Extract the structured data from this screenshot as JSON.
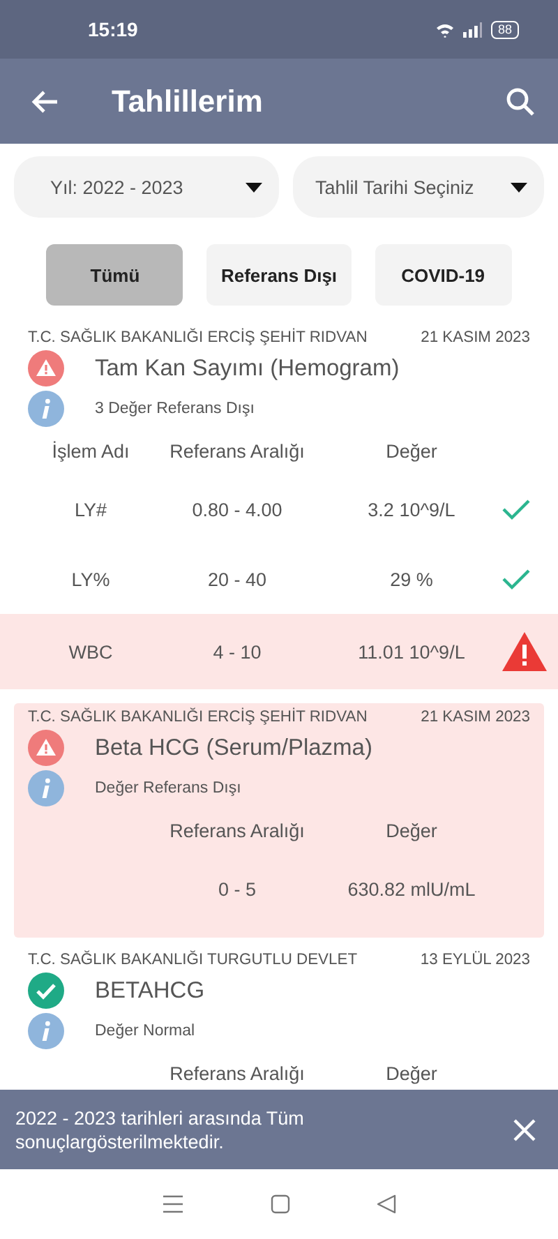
{
  "status_bar": {
    "time": "15:19",
    "battery": "88"
  },
  "app_bar": {
    "title": "Tahlillerim"
  },
  "filters": [
    {
      "value": "Yıl: 2022 - 2023"
    },
    {
      "value": "Tahlil Tarihi Seçiniz"
    }
  ],
  "tabs": [
    {
      "label": "Tümü",
      "selected": true
    },
    {
      "label": "Referans Dışı",
      "selected": false
    },
    {
      "label": "COVID-19",
      "selected": false
    }
  ],
  "results": [
    {
      "hospital": "T.C. SAĞLIK BAKANLIĞI ERCİŞ ŞEHİT RIDVAN",
      "date": "21 KASIM 2023",
      "kind": "alert",
      "highlighted": false,
      "title": "Tam Kan Sayımı (Hemogram)",
      "note": "3 Değer Referans Dışı",
      "columns": [
        {
          "kind": "name",
          "label": "İşlem Adı"
        },
        {
          "kind": "range",
          "label": "Referans Aralığı"
        },
        {
          "kind": "value",
          "label": "Değer"
        }
      ],
      "rows": [
        {
          "name": "LY#",
          "range": "0.80 - 4.00",
          "value": "3.2 10^9/L",
          "kind": "normal"
        },
        {
          "name": "LY%",
          "range": "20 - 40",
          "value": "29 %",
          "kind": "normal"
        },
        {
          "name": "WBC",
          "range": "4 - 10",
          "value": "11.01 10^9/L",
          "kind": "high"
        }
      ]
    },
    {
      "hospital": "T.C. SAĞLIK BAKANLIĞI ERCİŞ ŞEHİT RIDVAN",
      "date": "21 KASIM 2023",
      "kind": "alert",
      "highlighted": true,
      "title": "Beta HCG (Serum/Plazma)",
      "note": "Değer Referans Dışı",
      "columns": [
        {
          "kind": "range",
          "label": "Referans Aralığı"
        },
        {
          "kind": "value",
          "label": "Değer"
        }
      ],
      "rows": [
        {
          "range": "0 - 5",
          "value": "630.82 mlU/mL"
        }
      ]
    },
    {
      "hospital": "T.C. SAĞLIK BAKANLIĞI TURGUTLU DEVLET",
      "date": "13 EYLÜL 2023",
      "kind": "ok",
      "highlighted": false,
      "title": "BETAHCG",
      "note": "Değer Normal",
      "columns": [
        {
          "kind": "range",
          "label": "Referans Aralığı"
        },
        {
          "kind": "value",
          "label": "Değer"
        }
      ]
    }
  ],
  "snackbar": {
    "message": "2022 - 2023 tarihleri arasında Tüm sonuçlargösterilmektedir."
  }
}
